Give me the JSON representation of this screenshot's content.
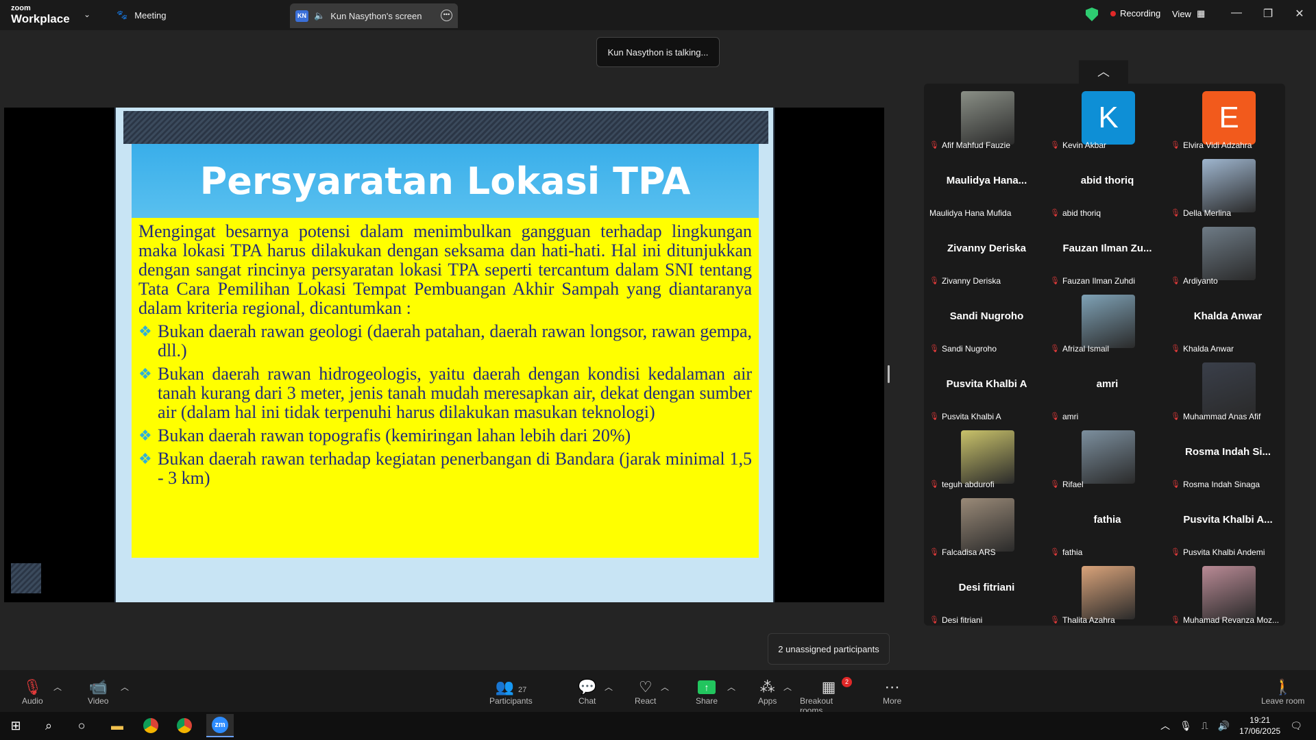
{
  "titlebar": {
    "logo_top": "zoom",
    "logo_bottom": "Workplace",
    "meeting_tab": "Meeting",
    "screen_badge": "KN",
    "screen_tab": "Kun Nasython's screen",
    "recording": "Recording",
    "view": "View"
  },
  "talking_notice": "Kun Nasython is talking...",
  "slide": {
    "title": "Persyaratan Lokasi TPA",
    "intro": "Mengingat besarnya potensi dalam menimbulkan gangguan terhadap lingkungan maka lokasi TPA harus dilakukan dengan seksama dan hati-hati. Hal ini ditunjukkan dengan sangat rincinya persyaratan lokasi TPA seperti tercantum dalam SNI tentang Tata Cara Pemilihan Lokasi Tempat Pembuangan Akhir Sampah yang diantaranya dalam kriteria regional, dicantumkan :",
    "bullets": [
      "Bukan daerah rawan geologi (daerah patahan, daerah rawan longsor, rawan gempa, dll.)",
      "Bukan daerah rawan hidrogeologis, yaitu daerah dengan kondisi kedalaman air tanah kurang dari 3 meter, jenis tanah mudah meresapkan air, dekat dengan sumber air (dalam hal ini tidak terpenuhi harus dilakukan masukan teknologi)",
      "Bukan daerah rawan topografis (kemiringan lahan lebih dari 20%)",
      "Bukan daerah rawan terhadap kegiatan penerbangan di Bandara (jarak minimal 1,5 - 3 km)"
    ]
  },
  "participants": [
    {
      "name": "Afif Mahfud Fauzie",
      "kind": "photo",
      "color": "#8a8f86"
    },
    {
      "name": "Kevin Akbar",
      "kind": "avatar",
      "letter": "K",
      "color": "#0e8fd6"
    },
    {
      "name": "Elvira Vidi Adzahra",
      "kind": "avatar",
      "letter": "E",
      "color": "#f25a1c"
    },
    {
      "name": "Maulidya Hana Mufida",
      "kind": "text",
      "big": "Maulidya  Hana..."
    },
    {
      "name": "abid thoriq",
      "kind": "text",
      "big": "abid thoriq"
    },
    {
      "name": "Della Merlina",
      "kind": "photo",
      "color": "#9fb6cf"
    },
    {
      "name": "Zivanny Deriska",
      "kind": "text",
      "big": "Zivanny Deriska"
    },
    {
      "name": "Fauzan Ilman Zuhdi",
      "kind": "text",
      "big": "Fauzan Ilman Zu..."
    },
    {
      "name": "Ardiyanto",
      "kind": "photo",
      "color": "#6e7b86"
    },
    {
      "name": "Sandi Nugroho",
      "kind": "text",
      "big": "Sandi Nugroho"
    },
    {
      "name": "Afrizal Ismail",
      "kind": "photo",
      "color": "#7fa2b6"
    },
    {
      "name": "Khalda Anwar",
      "kind": "text",
      "big": "Khalda Anwar"
    },
    {
      "name": "Pusvita Khalbi A",
      "kind": "text",
      "big": "Pusvita Khalbi A"
    },
    {
      "name": "amri",
      "kind": "text",
      "big": "amri"
    },
    {
      "name": "Muhammad Anas Afif",
      "kind": "photo",
      "color": "#3a3f4a"
    },
    {
      "name": "teguh abdurofi",
      "kind": "photo",
      "color": "#c9c26a"
    },
    {
      "name": "Rifael",
      "kind": "photo",
      "color": "#7c8f9e"
    },
    {
      "name": "Rosma Indah Sinaga",
      "kind": "text",
      "big": "Rosma Indah Si..."
    },
    {
      "name": "Falcadisa ARS",
      "kind": "photo",
      "color": "#9a8a78"
    },
    {
      "name": "fathia",
      "kind": "text",
      "big": "fathia"
    },
    {
      "name": "Pusvita Khalbi Andemi",
      "kind": "text",
      "big": "Pusvita Khalbi A..."
    },
    {
      "name": "Desi fitriani",
      "kind": "text",
      "big": "Desi fitriani"
    },
    {
      "name": "Thalita Azahra",
      "kind": "photo",
      "color": "#d9a37a"
    },
    {
      "name": "Muhamad Revanza Moz...",
      "kind": "photo",
      "color": "#b98a95"
    }
  ],
  "tooltip": "2 unassigned participants",
  "toolbar": {
    "audio": "Audio",
    "video": "Video",
    "participants": "Participants",
    "participants_count": "27",
    "chat": "Chat",
    "react": "React",
    "share": "Share",
    "apps": "Apps",
    "breakout": "Breakout rooms",
    "breakout_badge": "2",
    "more": "More",
    "leave": "Leave room"
  },
  "taskbar": {
    "time": "19:21",
    "date": "17/06/2025",
    "zoom_label": "zm"
  }
}
